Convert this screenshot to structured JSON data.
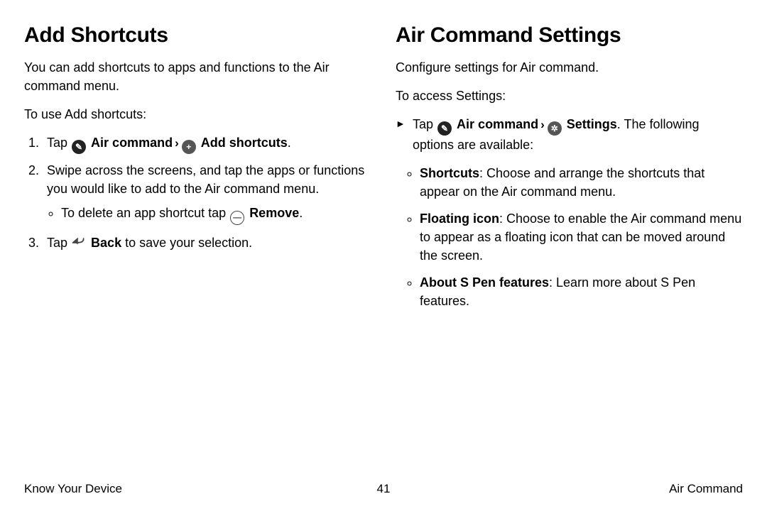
{
  "left": {
    "heading": "Add Shortcuts",
    "intro": "You can add shortcuts to apps and functions to the Air command menu.",
    "lead": "To use Add shortcuts:",
    "step1_prefix": "Tap ",
    "step1_aircmd": "Air command",
    "step1_addshort": "Add shortcuts",
    "step1_period": ".",
    "step2": "Swipe across the screens, and tap the apps or functions you would like to add to the Air command menu.",
    "step2_sub_prefix": "To delete an app shortcut tap ",
    "step2_sub_bold": "Remove",
    "step2_sub_period": ".",
    "step3_prefix": "Tap ",
    "step3_bold": "Back",
    "step3_suffix": " to save your selection."
  },
  "right": {
    "heading": "Air Command Settings",
    "intro": "Configure settings for Air command.",
    "lead": "To access Settings:",
    "tap_prefix": "Tap ",
    "aircmd": "Air command",
    "settings": "Settings",
    "tap_suffix": ". The following options are available:",
    "opt1_bold": "Shortcuts",
    "opt1_rest": ": Choose and arrange the shortcuts that appear on the Air command menu.",
    "opt2_bold": "Floating icon",
    "opt2_rest": ": Choose to enable the Air command menu to appear as a floating icon that can be moved around the screen.",
    "opt3_bold": "About S Pen features",
    "opt3_rest": ": Learn more about S Pen features."
  },
  "footer": {
    "left": "Know Your Device",
    "center": "41",
    "right": "Air Command"
  },
  "glyphs": {
    "pen": "✎",
    "plus": "+",
    "minus": "—",
    "gear": "✲",
    "chev": "›",
    "play": "►"
  }
}
